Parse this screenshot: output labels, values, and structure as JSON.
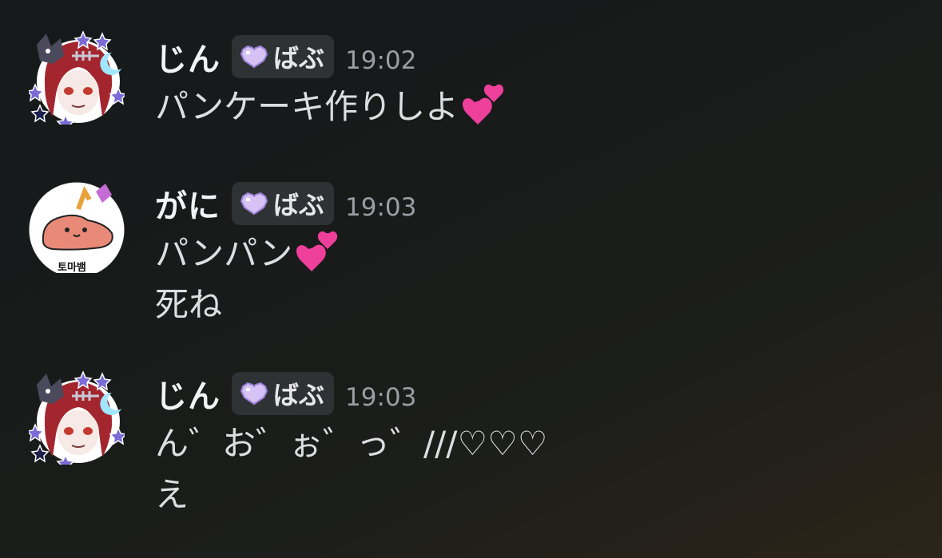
{
  "messages": [
    {
      "author": "じん",
      "tag": "ばぶ",
      "time": "19:02",
      "lines": [
        "パンケーキ作りしよ"
      ],
      "emoji": "two-hearts"
    },
    {
      "author": "がに",
      "tag": "ばぶ",
      "time": "19:03",
      "lines": [
        "パンパン",
        "死ね"
      ],
      "emoji": "two-hearts",
      "avatar_text": "토마뱀"
    },
    {
      "author": "じん",
      "tag": "ばぶ",
      "time": "19:03",
      "lines": [
        "ん゛お゛ぉ゛っ゛///♡♡♡",
        "え"
      ]
    }
  ],
  "colors": {
    "background": "#17191a",
    "username": "#f2f3f5",
    "message_text": "#dcdee1",
    "timestamp": "#9a9ea4",
    "tag_bg": "#2f3234",
    "tag_heart": "#cdb8f0",
    "emoji_heart": "#ee3f9b"
  },
  "icons": [
    "avatar-jin",
    "avatar-gani",
    "pixel-heart-icon",
    "two-hearts-emoji"
  ]
}
